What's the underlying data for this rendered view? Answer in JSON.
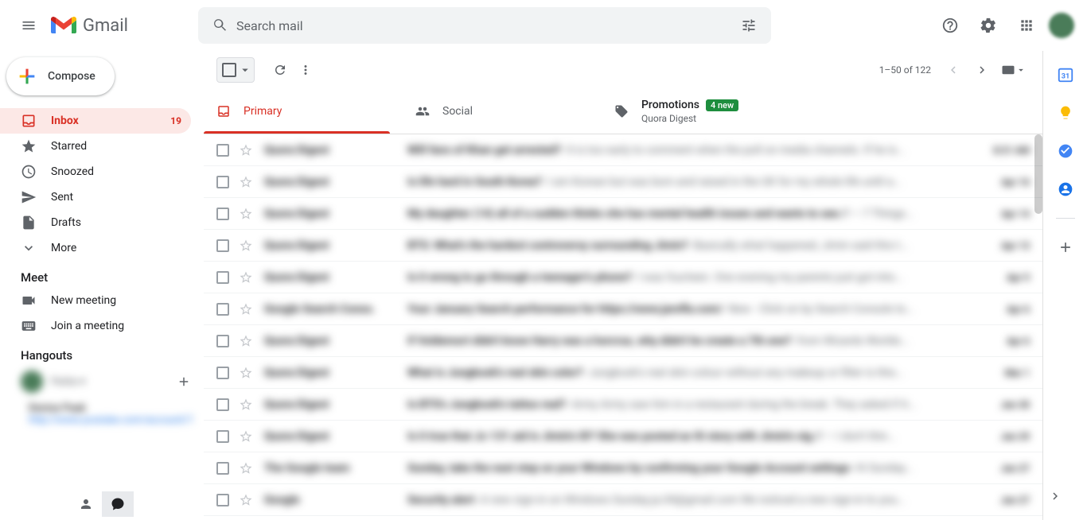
{
  "header": {
    "app_name": "Gmail",
    "search_placeholder": "Search mail"
  },
  "compose_label": "Compose",
  "nav": {
    "inbox": {
      "label": "Inbox",
      "count": "19"
    },
    "starred": {
      "label": "Starred"
    },
    "snoozed": {
      "label": "Snoozed"
    },
    "sent": {
      "label": "Sent"
    },
    "drafts": {
      "label": "Drafts"
    },
    "more": {
      "label": "More"
    }
  },
  "sections": {
    "meet": "Meet",
    "new_meeting": "New meeting",
    "join_meeting": "Join a meeting",
    "hangouts": "Hangouts"
  },
  "toolbar": {
    "page_info": "1–50 of 122"
  },
  "tabs": {
    "primary": "Primary",
    "social": "Social",
    "promotions": "Promotions",
    "promotions_badge": "4 new",
    "promotions_sub": "Quora Digest"
  },
  "emails": [
    {
      "sender": "Quora Digest",
      "subject": "Will fans of Khan get arrested?",
      "snippet": " - It is too early to comment when the poll on media channels. If he is...",
      "date": "8:31 AM"
    },
    {
      "sender": "Quora Digest",
      "subject": "Is life hard in South Korea?",
      "snippet": " - I am Korean but was born and raised in the UK for my whole life until a...",
      "date": "Apr 16"
    },
    {
      "sender": "Quora Digest",
      "subject": "My daughter (14) all of a sudden thinks she has mental health issues and wants to see.",
      "snippet": " If — 7 Things...",
      "date": "Apr 14"
    },
    {
      "sender": "Quora Digest",
      "subject": "BTS: What's the hardest controversy surrounding Jimin?",
      "snippet": " - Basically what happened, Jimin said this t...",
      "date": "Apr 13"
    },
    {
      "sender": "Quora Digest",
      "subject": "Is it wrong to go through a teenager's phone?",
      "snippet": " - I was fourteen. One evening my parents just got into...",
      "date": "Apr 9"
    },
    {
      "sender": "Google Search Conso.",
      "subject": "Your January Search performance for https://www.jarofla.com/",
      "snippet": " - New - Click on by Search Console to...",
      "date": "Apr 6"
    },
    {
      "sender": "Quora Digest",
      "subject": "If Voldemort didn't know Harry was a horcrux, why didn't he create a 7th one?",
      "snippet": " - from Wizards Worlds...",
      "date": "Apr 6"
    },
    {
      "sender": "Quora Digest",
      "subject": "What is Jungkook's real skin color?",
      "snippet": " - Jungkook's real skin colour without any makeup or filter is this...",
      "date": "Mar 1"
    },
    {
      "sender": "Quora Digest",
      "subject": "Is BTS's Jungkook's tattoo real?",
      "snippet": " - Army Army saw him in a restaurant during the break. They asked if it...",
      "date": "Jan 30"
    },
    {
      "sender": "Quora Digest",
      "subject": "Is it true that Jz-131 aid is Jimin's ID? She was posted as IG story with Jimin's sig.",
      "snippet": " If — I don't thin...",
      "date": "Jan 29"
    },
    {
      "sender": "The Google team",
      "subject": "Sunday, take the next step on your Windows by confirming your Google Account settings",
      "snippet": " - Hi Sunday...",
      "date": "Jan 27"
    },
    {
      "sender": "Google",
      "subject": "Security alert",
      "snippet": " - A new sign-in on Windows Sunday.ja.04@gmail.com We noticed a new sign-in to you...",
      "date": "Jan 27"
    }
  ]
}
